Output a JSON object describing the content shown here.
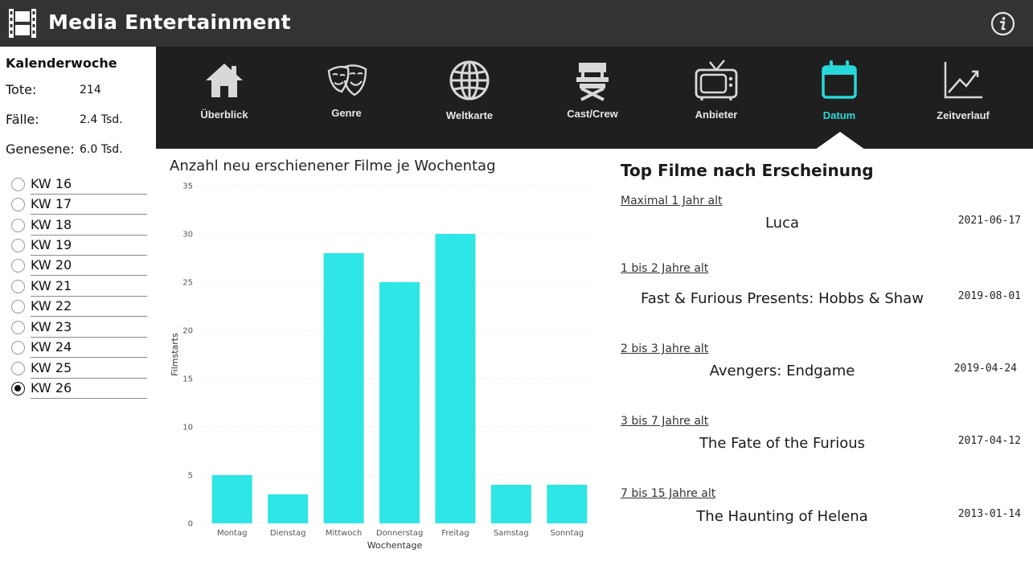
{
  "app": {
    "title": "Media Entertainment",
    "logo_icon": "film-strip-icon",
    "info_icon": "info-icon"
  },
  "sidebar": {
    "title": "Kalenderwoche",
    "stats": [
      {
        "label": "Tote:",
        "value": "214"
      },
      {
        "label": "Fälle:",
        "value": "2.4 Tsd."
      },
      {
        "label": "Genesene:",
        "value": "6.0 Tsd."
      }
    ],
    "weeks": [
      {
        "label": "KW 16",
        "selected": false
      },
      {
        "label": "KW 17",
        "selected": false
      },
      {
        "label": "KW 18",
        "selected": false
      },
      {
        "label": "KW 19",
        "selected": false
      },
      {
        "label": "KW 20",
        "selected": false
      },
      {
        "label": "KW 21",
        "selected": false
      },
      {
        "label": "KW 22",
        "selected": false
      },
      {
        "label": "KW 23",
        "selected": false
      },
      {
        "label": "KW 24",
        "selected": false
      },
      {
        "label": "KW 25",
        "selected": false
      },
      {
        "label": "KW 26",
        "selected": true
      }
    ]
  },
  "nav": {
    "items": [
      {
        "label": "Überblick",
        "icon": "home-icon",
        "active": false
      },
      {
        "label": "Genre",
        "icon": "theater-masks-icon",
        "active": false
      },
      {
        "label": "Weltkarte",
        "icon": "globe-icon",
        "active": false
      },
      {
        "label": "Cast/Crew",
        "icon": "director-chair-icon",
        "active": false
      },
      {
        "label": "Anbieter",
        "icon": "tv-icon",
        "active": false
      },
      {
        "label": "Datum",
        "icon": "calendar-icon",
        "active": true
      },
      {
        "label": "Zeitverlauf",
        "icon": "line-trend-icon",
        "active": false
      }
    ],
    "active_color": "#27d8d8"
  },
  "chart_data": {
    "type": "bar",
    "title": "Anzahl neu erschienener Filme je Wochentag",
    "xlabel": "Wochentage",
    "ylabel": "Filmstarts",
    "categories": [
      "Montag",
      "Dienstag",
      "Mittwoch",
      "Donnerstag",
      "Freitag",
      "Samstag",
      "Sonntag"
    ],
    "values": [
      5,
      3,
      28,
      25,
      30,
      4,
      4
    ],
    "ylim": [
      0,
      35
    ],
    "yticks": [
      0,
      5,
      10,
      15,
      20,
      25,
      30,
      35
    ],
    "bar_color": "#2ee6e6",
    "grid": true
  },
  "top_movies": {
    "title": "Top Filme nach Erscheinung",
    "entries": [
      {
        "category": "Maximal 1 Jahr alt",
        "title": "Luca",
        "date": "2021-06-17"
      },
      {
        "category": "1 bis 2 Jahre alt",
        "title": "Fast & Furious Presents: Hobbs & Shaw",
        "date": "2019-08-01"
      },
      {
        "category": "2 bis 3 Jahre alt",
        "title": "Avengers: Endgame",
        "date": "2019-04-24"
      },
      {
        "category": "3 bis 7 Jahre alt",
        "title": "The Fate of the Furious",
        "date": "2017-04-12"
      },
      {
        "category": "7 bis 15 Jahre alt",
        "title": "The Haunting of Helena",
        "date": "2013-01-14"
      }
    ]
  }
}
